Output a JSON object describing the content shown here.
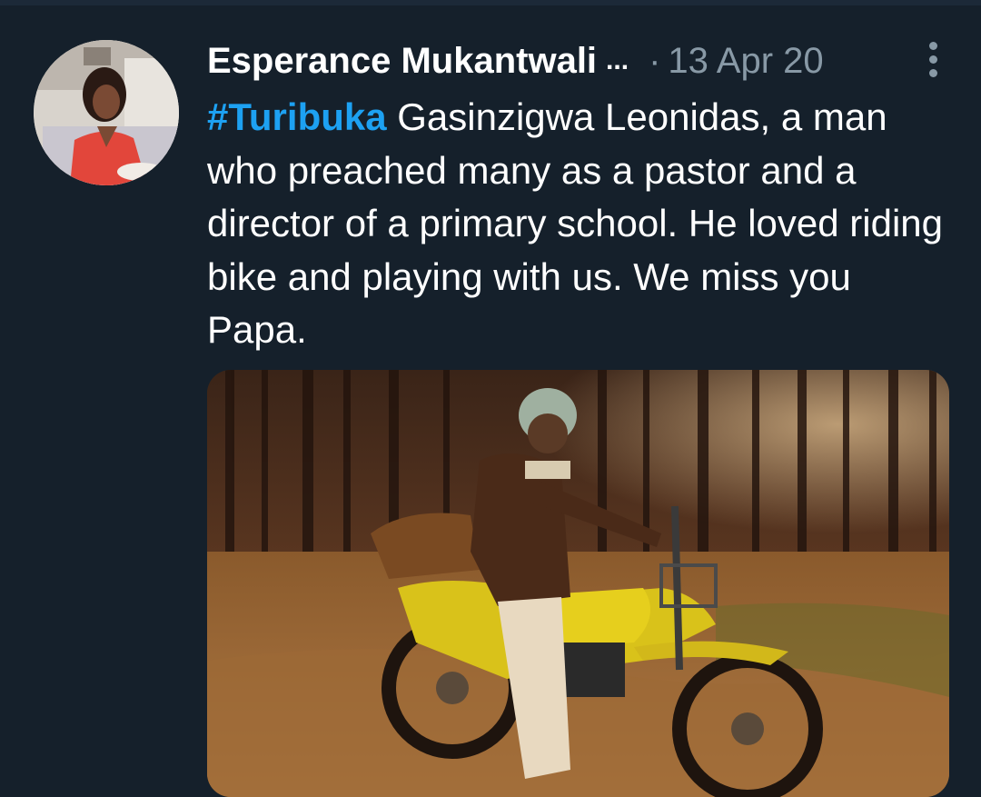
{
  "tweet": {
    "author_name": "Esperance Mukantwali",
    "name_truncation": "...",
    "separator": "·",
    "date": "13 Apr 20",
    "hashtag": "#Turibuka",
    "body": " Gasinzigwa Leonidas, a man who preached many as a pastor and a director of a primary school. He loved riding bike and playing with us. We miss you Papa.",
    "more_icon": "vertical-dots-icon"
  },
  "colors": {
    "background": "#15202b",
    "hashtag": "#1da1f2",
    "secondary_text": "#8899a6",
    "primary_text": "#ffffff"
  }
}
